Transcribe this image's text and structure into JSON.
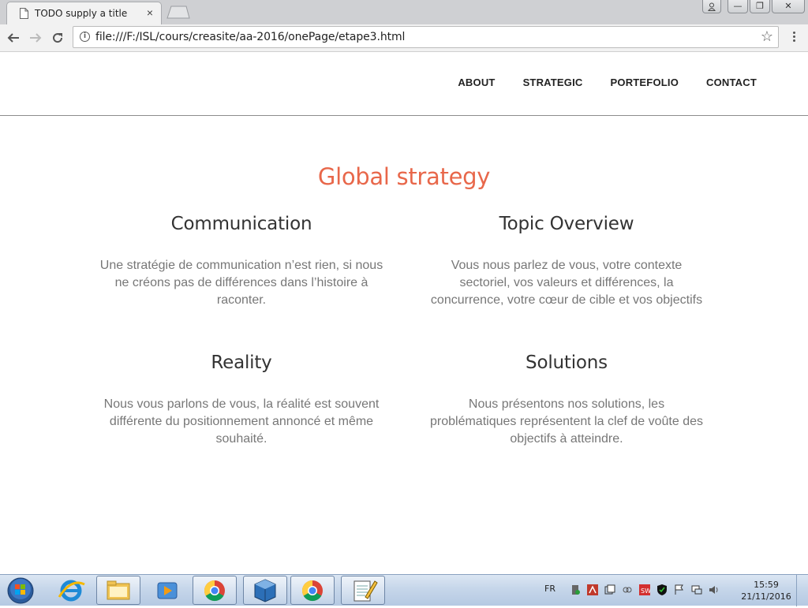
{
  "browser": {
    "tab_title": "TODO supply a title",
    "tab_close": "×",
    "url": "file:///F:/ISL/cours/creasite/aa-2016/onePage/etape3.html",
    "window_buttons": {
      "minimize": "—",
      "maximize": "❐",
      "close": "✕"
    }
  },
  "nav": {
    "items": [
      "ABOUT",
      "STRATEGIC",
      "PORTEFOLIO",
      "CONTACT"
    ]
  },
  "section": {
    "title": "Global strategy",
    "cards": [
      {
        "heading": "Communication",
        "text": "Une stratégie de communication n’est rien, si nous ne créons pas de différences dans l’histoire à raconter."
      },
      {
        "heading": "Topic Overview",
        "text": "Vous nous parlez de vous, votre contexte sectoriel, vos valeurs et différences, la concurrence, votre cœur de cible et vos objectifs"
      },
      {
        "heading": "Reality",
        "text": "Nous vous parlons de vous, la réalité est souvent différente du positionnement annoncé et même souhaité."
      },
      {
        "heading": "Solutions",
        "text": "Nous présentons nos solutions, les problématiques représentent la clef de voûte des objectifs à atteindre."
      }
    ]
  },
  "colors": {
    "accent": "#e8674a",
    "heading": "#333333",
    "body_text": "#777777"
  },
  "taskbar": {
    "language": "FR",
    "time": "15:59",
    "date": "21/11/2016",
    "apps": [
      "start-orb-icon",
      "internet-explorer-icon",
      "file-explorer-icon",
      "media-player-icon",
      "chrome-icon",
      "virtualbox-icon",
      "chrome-icon",
      "notepad-icon"
    ]
  }
}
